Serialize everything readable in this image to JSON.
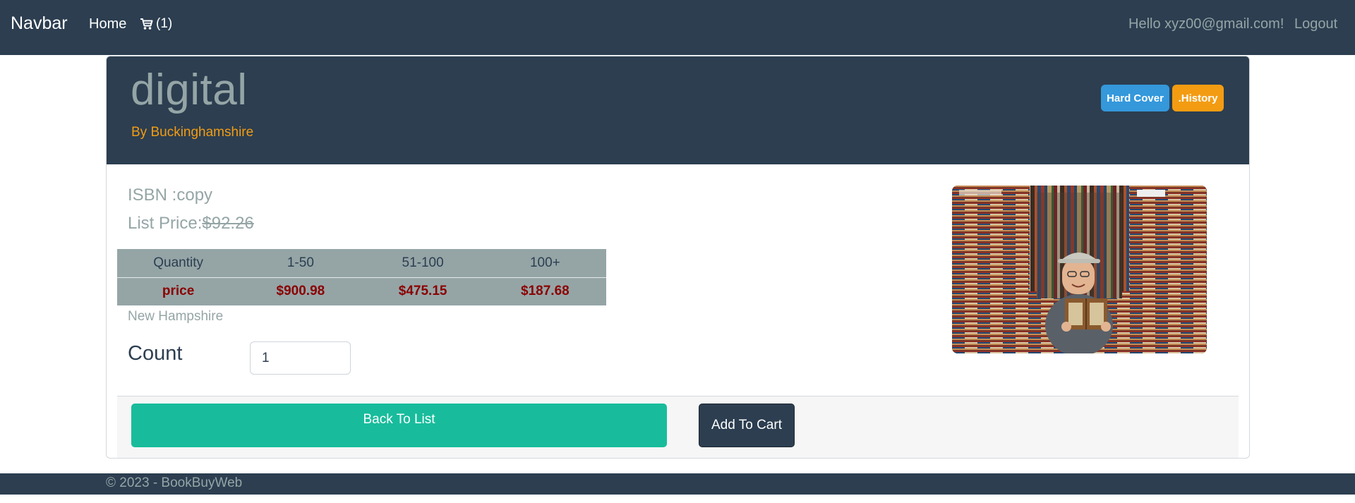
{
  "navbar": {
    "brand": "Navbar",
    "home": "Home",
    "cart_count": "(1)",
    "cart_icon": "cart-icon",
    "greeting": "Hello xyz00@gmail.com!",
    "logout": "Logout"
  },
  "book": {
    "title": "digital",
    "author": "By Buckinghamshire",
    "badges": [
      "Hard Cover",
      ".History"
    ],
    "isbn": "ISBN :copy",
    "list_price_label": "List Price:",
    "list_price": "$92.26",
    "location": "New Hampshire"
  },
  "pricing": {
    "headers": [
      "Quantity",
      "1-50",
      "51-100",
      "100+"
    ],
    "prices": [
      "price",
      "$900.98",
      "$475.15",
      "$187.68"
    ]
  },
  "order": {
    "count_label": "Count",
    "count_value": "1",
    "back_label": "Back To List",
    "add_label": "Add To Cart"
  },
  "footer": {
    "copyright": "© 2023 - BookBuyWeb"
  },
  "colors": {
    "primary": "#2c3e50",
    "muted": "#95a5a6",
    "success": "#18bc9c",
    "info": "#3498db",
    "warning": "#f39c12",
    "price_text": "#8b0000"
  }
}
